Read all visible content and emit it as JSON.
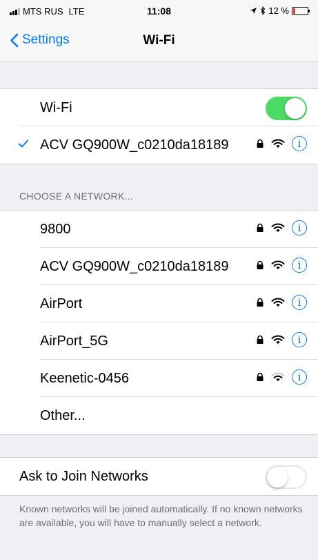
{
  "status": {
    "carrier": "MTS RUS",
    "network": "LTE",
    "time": "11:08",
    "battery": "12 %"
  },
  "nav": {
    "back_label": "Settings",
    "title": "Wi-Fi"
  },
  "wifi_toggle": {
    "label": "Wi-Fi",
    "on": true
  },
  "connected": {
    "name": "ACV GQ900W_c0210da18189"
  },
  "networks_header": "CHOOSE A NETWORK...",
  "networks": [
    {
      "name": "9800",
      "secured": true
    },
    {
      "name": "ACV GQ900W_c0210da18189",
      "secured": true
    },
    {
      "name": "AirPort",
      "secured": true
    },
    {
      "name": "AirPort_5G",
      "secured": true
    },
    {
      "name": "Keenetic-0456",
      "secured": true
    }
  ],
  "other_label": "Other...",
  "ask_to_join": {
    "label": "Ask to Join Networks",
    "on": false
  },
  "footer": "Known networks will be joined automatically. If no known networks are available, you will have to manually select a network.",
  "colors": {
    "accent": "#007aff",
    "toggle_on": "#4cd964",
    "battery_low": "#ff3b30"
  }
}
